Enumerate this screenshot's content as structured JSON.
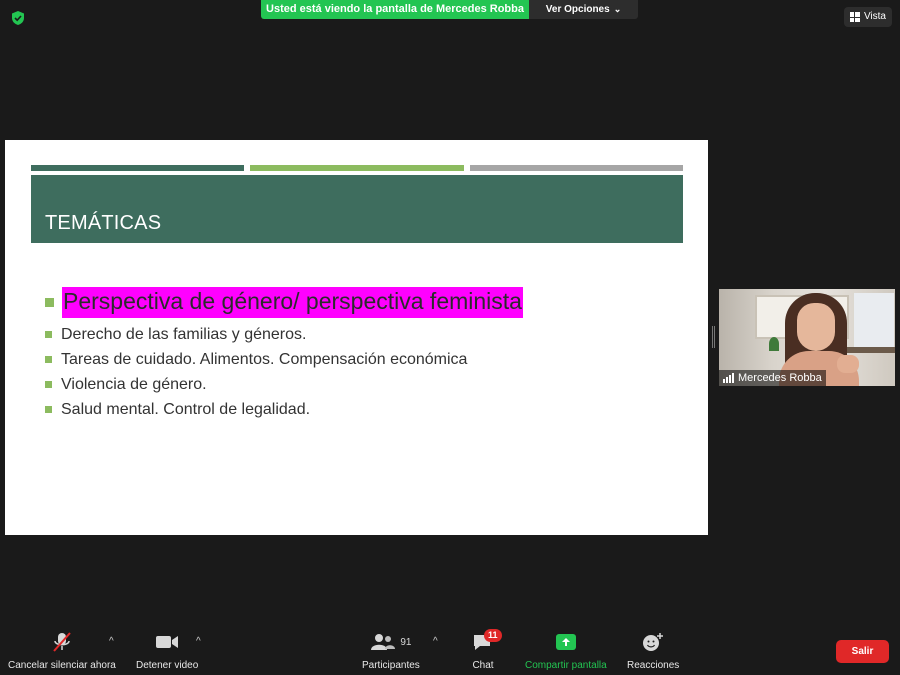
{
  "top_bar": {
    "banner_text": "Usted está viendo la pantalla de Mercedes Robba",
    "view_options_label": "Ver Opciones",
    "vista_label": "Vista",
    "security_icon": "shield-check-icon",
    "accent_color": "#23c552"
  },
  "slide": {
    "title": "TEMÁTICAS",
    "stripe_colors": [
      "#3e6d5e",
      "#8cbb5f",
      "#a6a6a6"
    ],
    "title_band_color": "#3e6d5e",
    "highlight_color": "#ff00ff",
    "highlighted_bullet": "Perspectiva de género/ perspectiva feminista",
    "bullets": [
      "Derecho de las familias y géneros.",
      "Tareas de cuidado. Alimentos. Compensación económica",
      "Violencia de género.",
      "Salud mental. Control de legalidad."
    ]
  },
  "participant_video": {
    "name": "Mercedes Robba"
  },
  "toolbar": {
    "mute_label": "Cancelar silenciar ahora",
    "video_label": "Detener video",
    "participants_label": "Participantes",
    "participants_count": "91",
    "chat_label": "Chat",
    "chat_badge": "11",
    "share_label": "Compartir pantalla",
    "reactions_label": "Reacciones",
    "leave_label": "Salir",
    "leave_color": "#e02828"
  }
}
